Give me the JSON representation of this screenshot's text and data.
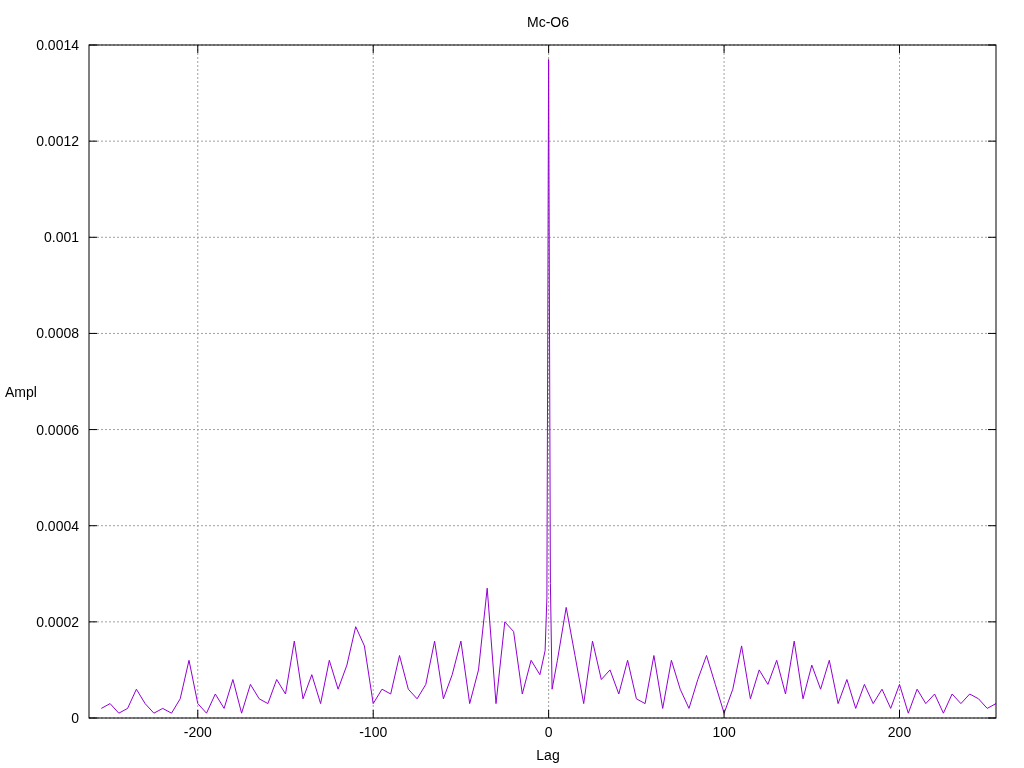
{
  "chart_data": {
    "type": "line",
    "title": "Mc-O6",
    "xlabel": "Lag",
    "ylabel": "Ampl",
    "xlim": [
      -262,
      255
    ],
    "ylim": [
      0,
      0.0014
    ],
    "grid": true,
    "xticks": [
      {
        "value": -200,
        "label": "-200"
      },
      {
        "value": -100,
        "label": "-100"
      },
      {
        "value": 0,
        "label": "0"
      },
      {
        "value": 100,
        "label": "100"
      },
      {
        "value": 200,
        "label": "200"
      }
    ],
    "yticks": [
      {
        "value": 0,
        "label": "0"
      },
      {
        "value": 0.0002,
        "label": "0.0002"
      },
      {
        "value": 0.0004,
        "label": "0.0004"
      },
      {
        "value": 0.0006,
        "label": "0.0006"
      },
      {
        "value": 0.0008,
        "label": "0.0008"
      },
      {
        "value": 0.001,
        "label": "0.001"
      },
      {
        "value": 0.0012,
        "label": "0.0012"
      },
      {
        "value": 0.0014,
        "label": "0.0014"
      }
    ],
    "x": [
      -255,
      -250,
      -245,
      -240,
      -235,
      -230,
      -225,
      -220,
      -215,
      -210,
      -205,
      -200,
      -195,
      -190,
      -185,
      -180,
      -175,
      -170,
      -165,
      -160,
      -155,
      -150,
      -145,
      -140,
      -135,
      -130,
      -125,
      -120,
      -115,
      -110,
      -105,
      -100,
      -95,
      -90,
      -85,
      -80,
      -75,
      -70,
      -65,
      -60,
      -55,
      -50,
      -45,
      -40,
      -35,
      -30,
      -25,
      -20,
      -15,
      -10,
      -5,
      -2,
      -1,
      0,
      1,
      2,
      5,
      10,
      15,
      20,
      25,
      30,
      35,
      40,
      45,
      50,
      55,
      60,
      65,
      70,
      75,
      80,
      85,
      90,
      95,
      100,
      105,
      110,
      115,
      120,
      125,
      130,
      135,
      140,
      145,
      150,
      155,
      160,
      165,
      170,
      175,
      180,
      185,
      190,
      195,
      200,
      205,
      210,
      215,
      220,
      225,
      230,
      235,
      240,
      245,
      250,
      255
    ],
    "series": [
      {
        "color": "#9400d3",
        "values": [
          2e-05,
          3e-05,
          1e-05,
          2e-05,
          6e-05,
          3e-05,
          1e-05,
          2e-05,
          1e-05,
          4e-05,
          0.00012,
          3e-05,
          1e-05,
          5e-05,
          2e-05,
          8e-05,
          1e-05,
          7e-05,
          4e-05,
          3e-05,
          8e-05,
          5e-05,
          0.00016,
          4e-05,
          9e-05,
          3e-05,
          0.00012,
          6e-05,
          0.00011,
          0.00019,
          0.00015,
          3e-05,
          6e-05,
          5e-05,
          0.00013,
          6e-05,
          4e-05,
          7e-05,
          0.00016,
          4e-05,
          9e-05,
          0.00016,
          3e-05,
          0.0001,
          0.00027,
          3e-05,
          0.0002,
          0.00018,
          5e-05,
          0.00012,
          9e-05,
          0.00014,
          0.00025,
          0.00137,
          0.00028,
          6e-05,
          0.00012,
          0.00023,
          0.00013,
          3e-05,
          0.00016,
          8e-05,
          0.0001,
          5e-05,
          0.00012,
          4e-05,
          3e-05,
          0.00013,
          2e-05,
          0.00012,
          6e-05,
          2e-05,
          8e-05,
          0.00013,
          7e-05,
          1e-05,
          6e-05,
          0.00015,
          4e-05,
          0.0001,
          7e-05,
          0.00012,
          5e-05,
          0.00016,
          4e-05,
          0.00011,
          6e-05,
          0.00012,
          3e-05,
          8e-05,
          2e-05,
          7e-05,
          3e-05,
          6e-05,
          2e-05,
          7e-05,
          1e-05,
          6e-05,
          3e-05,
          5e-05,
          1e-05,
          5e-05,
          3e-05,
          5e-05,
          4e-05,
          2e-05,
          3e-05
        ]
      }
    ]
  }
}
